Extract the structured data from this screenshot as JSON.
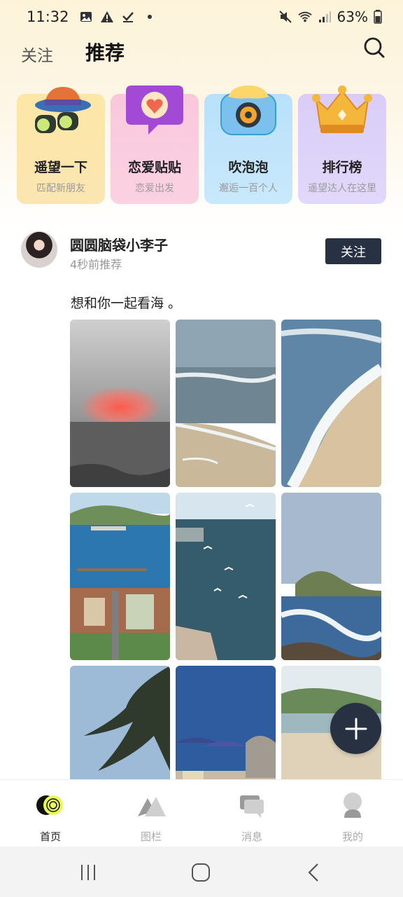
{
  "status_bar": {
    "time": "11:32",
    "battery": "63%"
  },
  "header": {
    "tab_follow": "关注",
    "tab_recommend": "推荐",
    "accent_color": "#e9f95a"
  },
  "feature_cards": [
    {
      "title": "遥望一下",
      "subtitle": "匹配新朋友",
      "icon": "hat-binoculars-icon"
    },
    {
      "title": "恋爱贴贴",
      "subtitle": "恋爱出发",
      "icon": "heart-bubble-icon"
    },
    {
      "title": "吹泡泡",
      "subtitle": "邂逅一百个人",
      "icon": "camera-icon"
    },
    {
      "title": "排行榜",
      "subtitle": "遥望达人在这里",
      "icon": "crown-icon"
    }
  ],
  "post": {
    "username": "圆圆脑袋小李子",
    "time": "4秒前推荐",
    "follow_label": "关注",
    "text": "想和你一起看海 。"
  },
  "bottom_nav": [
    {
      "label": "首页",
      "icon": "home-icon",
      "active": true
    },
    {
      "label": "图栏",
      "icon": "gallery-icon",
      "active": false
    },
    {
      "label": "消息",
      "icon": "message-icon",
      "active": false
    },
    {
      "label": "我的",
      "icon": "profile-icon",
      "active": false
    }
  ]
}
